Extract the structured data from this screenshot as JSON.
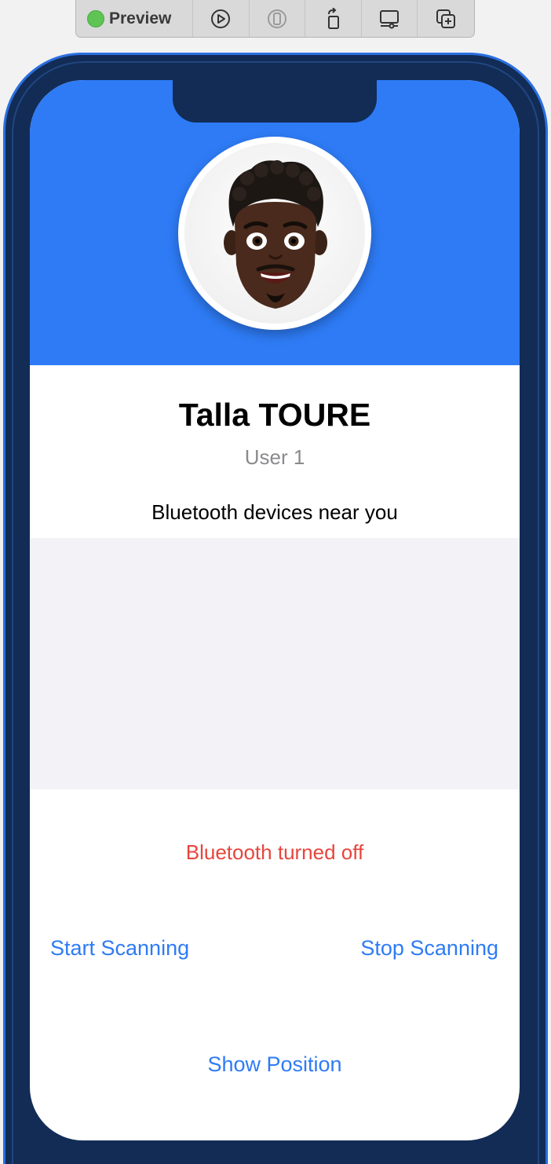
{
  "toolbar": {
    "preview_label": "Preview",
    "status_color": "#5ec454",
    "icons": [
      "play-icon",
      "device-icon",
      "rotate-icon",
      "display-settings-icon",
      "duplicate-icon"
    ]
  },
  "profile": {
    "name": "Talla TOURE",
    "subtitle": "User 1",
    "avatar": "memoji-avatar"
  },
  "devices": {
    "section_title": "Bluetooth devices near you",
    "items": []
  },
  "bluetooth": {
    "status_text": "Bluetooth turned off",
    "status_color": "#e8453c"
  },
  "actions": {
    "start_label": "Start Scanning",
    "stop_label": "Stop Scanning",
    "show_position_label": "Show Position"
  },
  "colors": {
    "accent": "#2e7bf5",
    "phone_frame": "#122c56",
    "list_background": "#f2f2f7"
  }
}
